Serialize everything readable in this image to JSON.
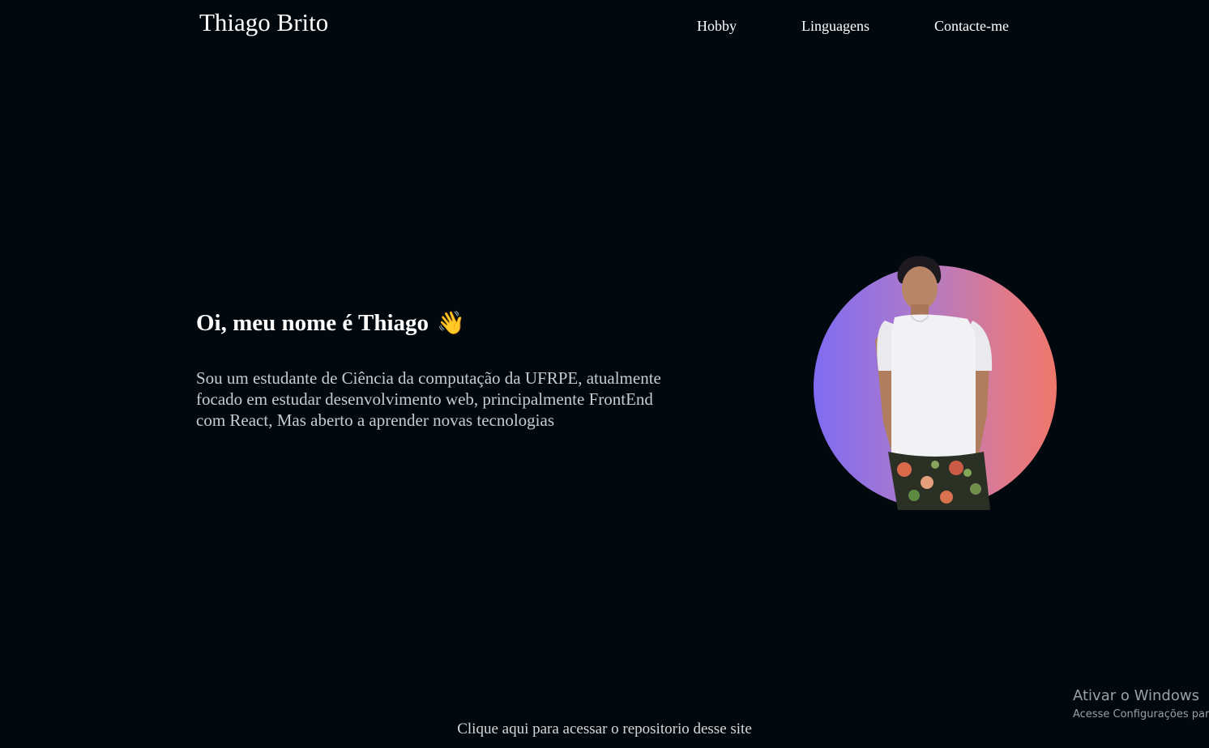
{
  "header": {
    "brand": "Thiago Brito",
    "nav": [
      "Hobby",
      "Linguagens",
      "Contacte-me"
    ]
  },
  "intro": {
    "greeting": "Oi, meu nome é Thiago",
    "wave_emoji": "👋",
    "bio": "Sou um estudante de Ciência da computação da UFRPE, atualmente focado em estudar desenvolvimento web, principalmente FrontEnd com React, Mas aberto a aprender novas tecnologias"
  },
  "hero": {
    "gradient_start": "#7f6cf2",
    "gradient_end": "#ee776a"
  },
  "footer": {
    "repo_link": "Clique aqui para acessar o repositorio desse site"
  },
  "os_watermark": {
    "title": "Ativar o Windows",
    "subtitle": "Acesse Configurações par"
  },
  "colors": {
    "background": "#01080e",
    "text": "#ffffff",
    "bio_text": "#c8ccd0"
  }
}
